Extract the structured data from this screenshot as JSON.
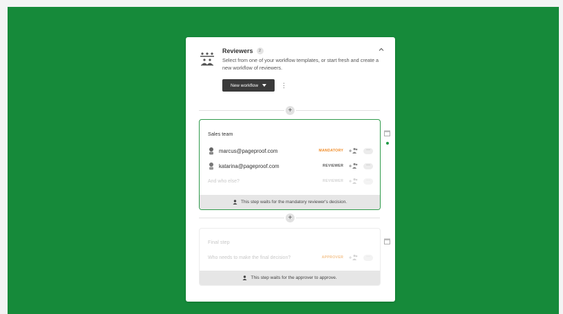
{
  "reviewers": {
    "title": "Reviewers",
    "count": "2",
    "description": "Select from one of your workflow templates, or start fresh and create a new workflow of reviewers.",
    "new_workflow_label": "New workflow",
    "kebab": "⋮",
    "collapse_glyph": "^"
  },
  "steps": [
    {
      "title": "Sales team",
      "members": [
        {
          "email": "marcus@pageproof.com",
          "role": "MANDATORY"
        },
        {
          "email": "katarina@pageproof.com",
          "role": "REVIEWER"
        }
      ],
      "add_placeholder": "And who else?",
      "add_role": "REVIEWER",
      "footer": "This step waits for the mandatory reviewer's decision."
    },
    {
      "title": "Final step",
      "add_placeholder": "Who needs to make the final decision?",
      "add_role": "APPROVER",
      "footer": "This step waits for the approver to approve."
    }
  ],
  "glyphs": {
    "plus": "+",
    "more": "···"
  },
  "colors": {
    "background": "#168a3a",
    "active_border": "#2e9a4a",
    "mandatory": "#f08a24",
    "button": "#3a3a3a"
  },
  "icons": [
    "reviewers-group-icon",
    "chevron-up-icon",
    "caret-down-icon",
    "add-person-icon",
    "more-icon",
    "person-icon",
    "calendar-icon"
  ]
}
